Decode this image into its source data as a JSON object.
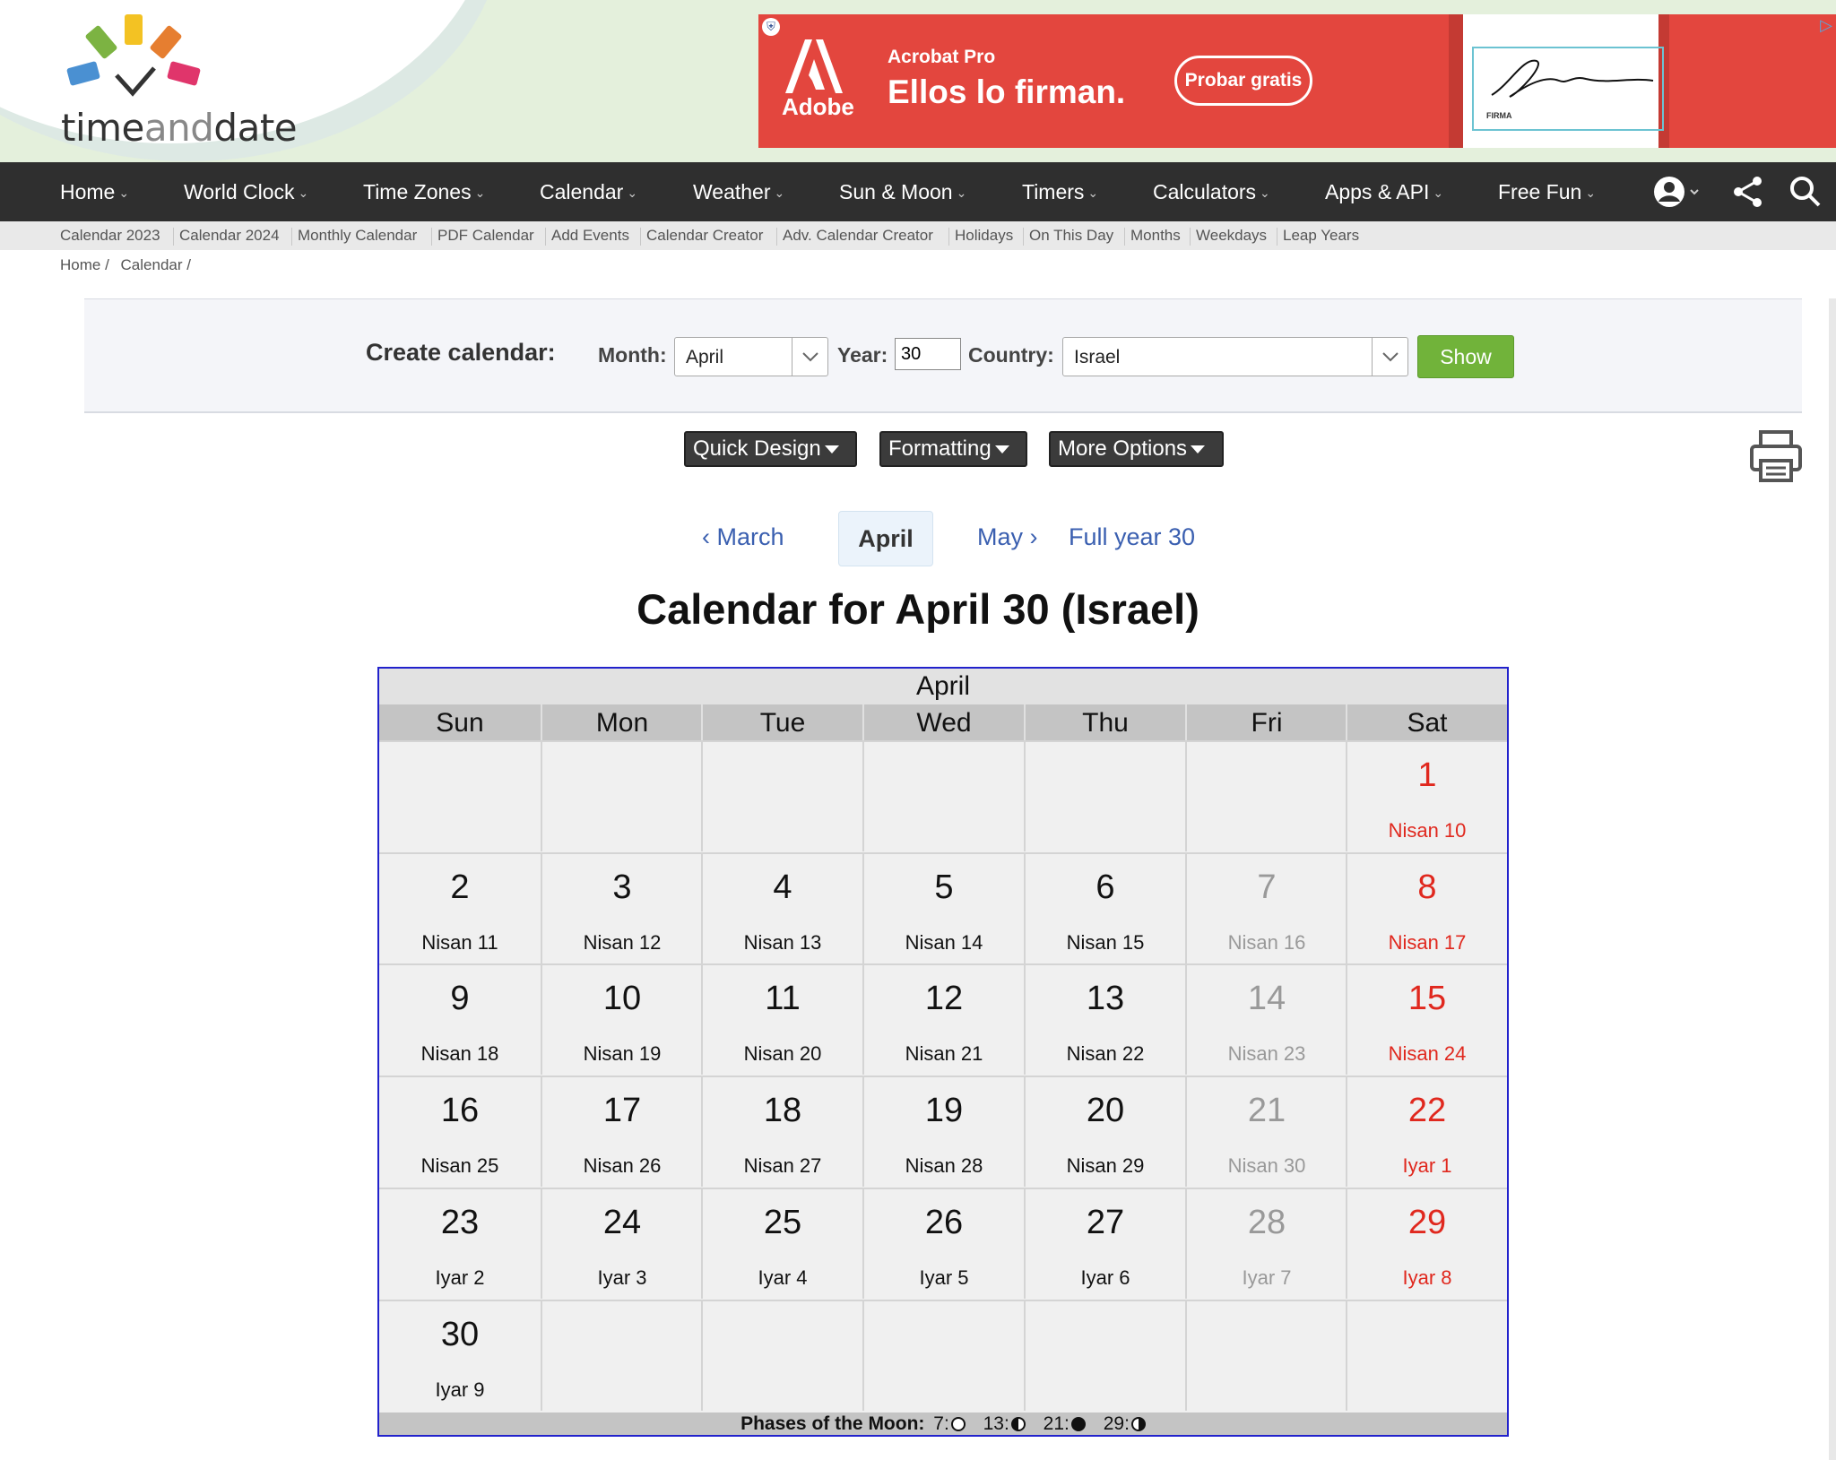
{
  "logo": {
    "text_dark": "time",
    "text_light": "and",
    "text_dark2": "date"
  },
  "ad": {
    "brand": "Adobe",
    "product": "Acrobat Pro",
    "headline": "Ellos lo firman.",
    "cta": "Probar gratis",
    "signature_label": "FIRMA",
    "accent_color": "#e3463e"
  },
  "nav": {
    "items": [
      {
        "label": "Home"
      },
      {
        "label": "World Clock"
      },
      {
        "label": "Time Zones"
      },
      {
        "label": "Calendar"
      },
      {
        "label": "Weather"
      },
      {
        "label": "Sun & Moon"
      },
      {
        "label": "Timers"
      },
      {
        "label": "Calculators"
      },
      {
        "label": "Apps & API"
      },
      {
        "label": "Free Fun"
      }
    ],
    "icons": [
      "user-icon",
      "share-icon",
      "search-icon"
    ]
  },
  "subnav": {
    "items": [
      "Calendar 2023",
      "Calendar 2024",
      "Monthly Calendar",
      "PDF Calendar",
      "Add Events",
      "Calendar Creator",
      "Adv. Calendar Creator",
      "Holidays",
      "On This Day",
      "Months",
      "Weekdays",
      "Leap Years"
    ]
  },
  "breadcrumb": [
    "Home /",
    "Calendar /"
  ],
  "create_form": {
    "title": "Create calendar:",
    "month_label": "Month:",
    "month_value": "April",
    "year_label": "Year:",
    "year_value": "30",
    "country_label": "Country:",
    "country_value": "Israel",
    "show_label": "Show",
    "show_color": "#71b33a"
  },
  "design_buttons": {
    "quick_design": "Quick Design",
    "formatting": "Formatting",
    "more_options": "More Options"
  },
  "month_nav": {
    "prev": "March",
    "current": "April",
    "next": "May",
    "full_year": "Full year 30"
  },
  "title": "Calendar for April 30 (Israel)",
  "calendar": {
    "month": "April",
    "weekdays": [
      "Sun",
      "Mon",
      "Tue",
      "Wed",
      "Thu",
      "Fri",
      "Sat"
    ],
    "weeks": [
      [
        null,
        null,
        null,
        null,
        null,
        null,
        {
          "day": "1",
          "hebrew": "Nisan 10"
        }
      ],
      [
        {
          "day": "2",
          "hebrew": "Nisan 11"
        },
        {
          "day": "3",
          "hebrew": "Nisan 12"
        },
        {
          "day": "4",
          "hebrew": "Nisan 13"
        },
        {
          "day": "5",
          "hebrew": "Nisan 14"
        },
        {
          "day": "6",
          "hebrew": "Nisan 15"
        },
        {
          "day": "7",
          "hebrew": "Nisan 16"
        },
        {
          "day": "8",
          "hebrew": "Nisan 17"
        }
      ],
      [
        {
          "day": "9",
          "hebrew": "Nisan 18"
        },
        {
          "day": "10",
          "hebrew": "Nisan 19"
        },
        {
          "day": "11",
          "hebrew": "Nisan 20"
        },
        {
          "day": "12",
          "hebrew": "Nisan 21"
        },
        {
          "day": "13",
          "hebrew": "Nisan 22"
        },
        {
          "day": "14",
          "hebrew": "Nisan 23"
        },
        {
          "day": "15",
          "hebrew": "Nisan 24"
        }
      ],
      [
        {
          "day": "16",
          "hebrew": "Nisan 25"
        },
        {
          "day": "17",
          "hebrew": "Nisan 26"
        },
        {
          "day": "18",
          "hebrew": "Nisan 27"
        },
        {
          "day": "19",
          "hebrew": "Nisan 28"
        },
        {
          "day": "20",
          "hebrew": "Nisan 29"
        },
        {
          "day": "21",
          "hebrew": "Nisan 30"
        },
        {
          "day": "22",
          "hebrew": "Iyar 1"
        }
      ],
      [
        {
          "day": "23",
          "hebrew": "Iyar 2"
        },
        {
          "day": "24",
          "hebrew": "Iyar 3"
        },
        {
          "day": "25",
          "hebrew": "Iyar 4"
        },
        {
          "day": "26",
          "hebrew": "Iyar 5"
        },
        {
          "day": "27",
          "hebrew": "Iyar 6"
        },
        {
          "day": "28",
          "hebrew": "Iyar 7"
        },
        {
          "day": "29",
          "hebrew": "Iyar 8"
        }
      ],
      [
        {
          "day": "30",
          "hebrew": "Iyar 9"
        },
        null,
        null,
        null,
        null,
        null,
        null
      ]
    ],
    "colors": {
      "weekend_sat": "#e0281e",
      "weekend_fri": "#999999",
      "border": "#2222cc"
    },
    "moon_phases": {
      "label": "Phases of the Moon:",
      "phases": [
        {
          "day": "7:",
          "icon": "full-moon-icon"
        },
        {
          "day": "13:",
          "icon": "last-quarter-icon"
        },
        {
          "day": "21:",
          "icon": "new-moon-icon"
        },
        {
          "day": "29:",
          "icon": "first-quarter-icon"
        }
      ]
    }
  }
}
